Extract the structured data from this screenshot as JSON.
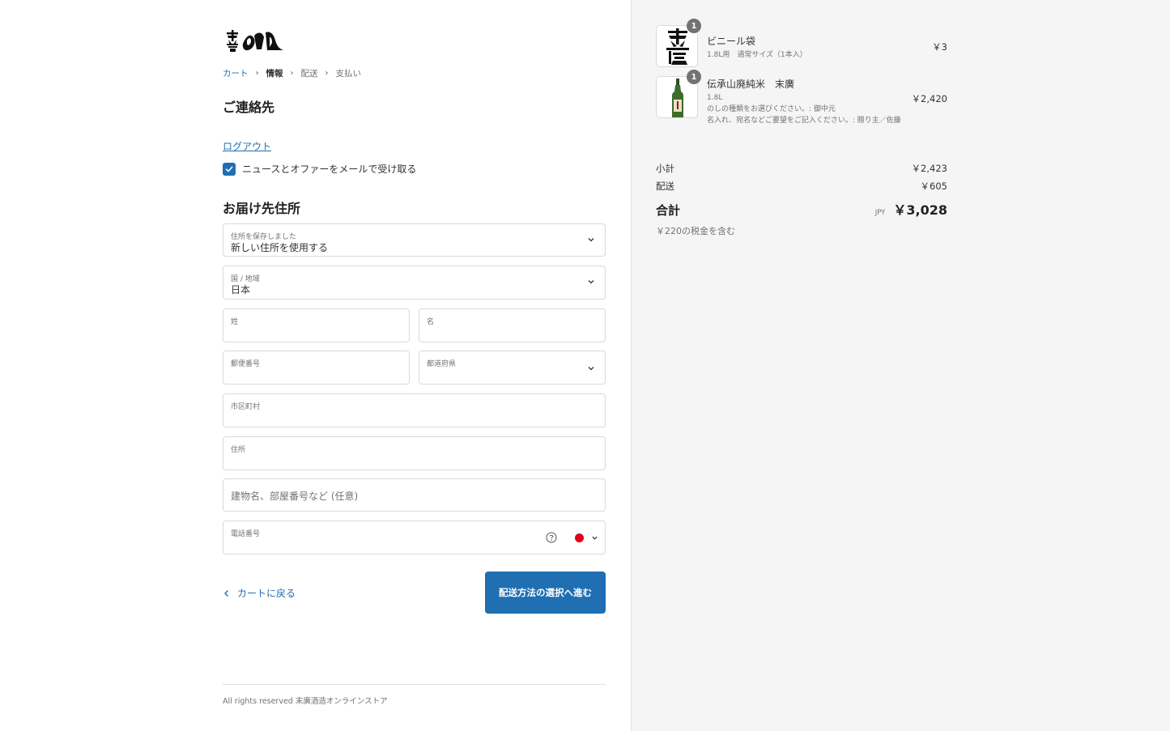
{
  "breadcrumb": {
    "cart": "カート",
    "info": "情報",
    "shipping": "配送",
    "payment": "支払い"
  },
  "contact": {
    "heading": "ご連絡先",
    "logout": "ログアウト",
    "newsletter_label": "ニュースとオファーをメールで受け取る",
    "newsletter_checked": true
  },
  "address": {
    "heading": "お届け先住所",
    "saved_label": "住所を保存しました",
    "saved_value": "新しい住所を使用する",
    "country_label": "国 / 地域",
    "country_value": "日本",
    "last_name_label": "姓",
    "first_name_label": "名",
    "zip_label": "郵便番号",
    "prefecture_label": "都道府県",
    "city_label": "市区町村",
    "address_label": "住所",
    "building_placeholder": "建物名、部屋番号など (任意)",
    "phone_label": "電話番号"
  },
  "actions": {
    "back": "カートに戻る",
    "continue": "配送方法の選択へ進む"
  },
  "footer": {
    "text": "All rights reserved 末廣酒造オンラインストア"
  },
  "order": {
    "items": [
      {
        "qty": "1",
        "name": "ビニール袋",
        "sub1": "1.8L用　通常サイズ（1本入）",
        "price": "￥3"
      },
      {
        "qty": "1",
        "name": "伝承山廃純米　末廣",
        "sub1": "1.8L",
        "sub2": "のしの種類をお選びください。: 御中元",
        "sub3": "名入れ、宛名などご要望をご記入ください。: 贈り主／佐藤",
        "price": "￥2,420"
      }
    ],
    "subtotal_label": "小計",
    "subtotal_value": "￥2,423",
    "shipping_label": "配送",
    "shipping_value": "￥605",
    "total_label": "合計",
    "currency": "JPY",
    "total_value": "￥3,028",
    "tax_note": "￥220の税金を含む"
  },
  "colors": {
    "accent": "#1f6fb2",
    "badge": "#737373",
    "flag_red": "#e0001b"
  }
}
